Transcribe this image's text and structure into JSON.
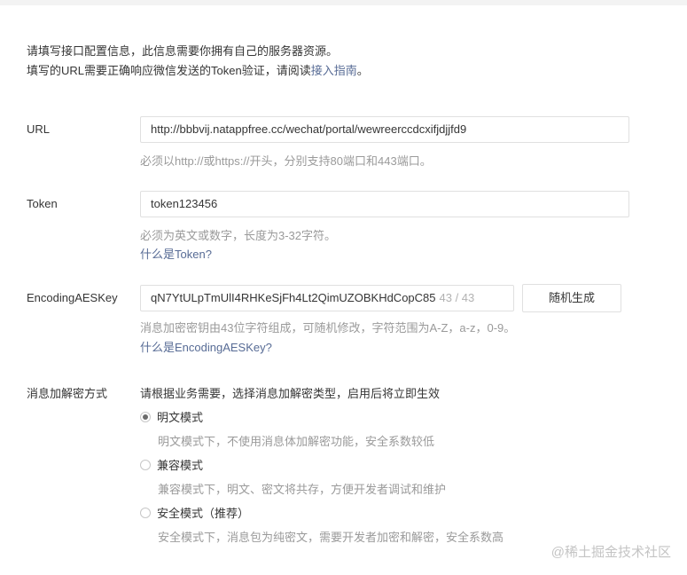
{
  "intro": {
    "line1": "请填写接口配置信息，此信息需要你拥有自己的服务器资源。",
    "line2_prefix": "填写的URL需要正确响应微信发送的Token验证，请阅读",
    "line2_link": "接入指南",
    "line2_suffix": "。"
  },
  "url": {
    "label": "URL",
    "value": "http://bbbvij.natappfree.cc/wechat/portal/wewreerccdcxifjdjjfd9",
    "tip": "必须以http://或https://开头，分别支持80端口和443端口。"
  },
  "token": {
    "label": "Token",
    "value": "token123456",
    "tip": "必须为英文或数字，长度为3-32字符。",
    "help": "什么是Token?"
  },
  "aes": {
    "label": "EncodingAESKey",
    "value": "qN7YtULpTmUlI4RHKeSjFh4Lt2QimUZOBKHdCopC85",
    "counter": "43 / 43",
    "button": "随机生成",
    "tip": "消息加密密钥由43位字符组成，可随机修改，字符范围为A-Z，a-z，0-9。",
    "help": "什么是EncodingAESKey?"
  },
  "encrypt": {
    "label": "消息加解密方式",
    "description": "请根据业务需要，选择消息加解密类型，启用后将立即生效",
    "options": [
      {
        "label": "明文模式",
        "desc": "明文模式下，不使用消息体加解密功能，安全系数较低",
        "checked": true
      },
      {
        "label": "兼容模式",
        "desc": "兼容模式下，明文、密文将共存，方便开发者调试和维护",
        "checked": false
      },
      {
        "label": "安全模式（推荐）",
        "desc": "安全模式下，消息包为纯密文，需要开发者加密和解密，安全系数高",
        "checked": false
      }
    ]
  },
  "watermark": "@稀土掘金技术社区"
}
